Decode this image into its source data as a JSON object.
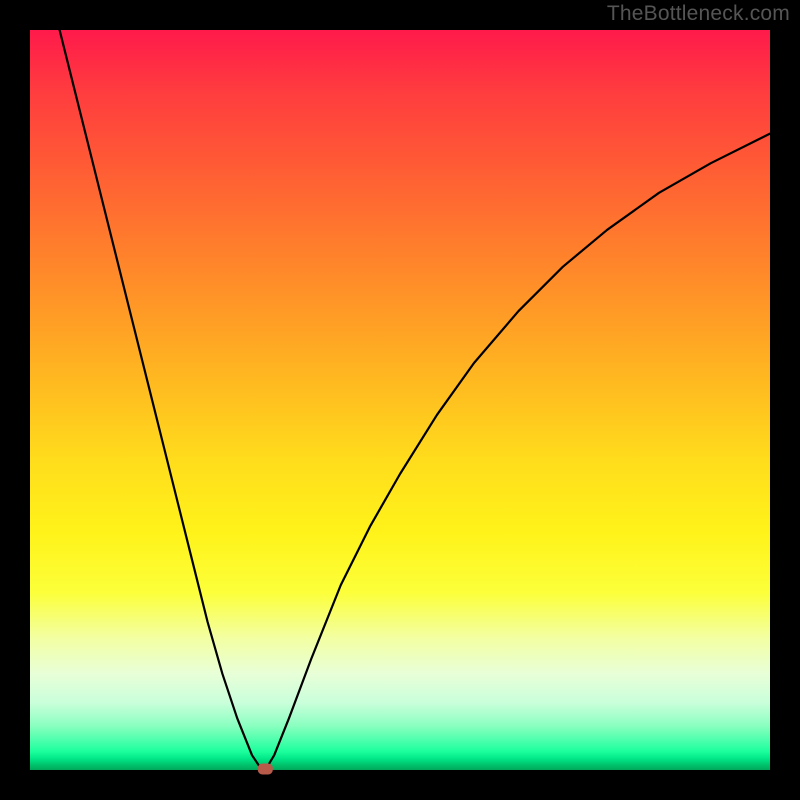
{
  "attribution": "TheBottleneck.com",
  "colors": {
    "frame": "#000000",
    "curve_stroke": "#000000",
    "marker_fill": "#b85a4a",
    "gradient_stops": [
      "#ff1a4b",
      "#ff3b3f",
      "#ff5a35",
      "#ff7a2d",
      "#ff9a26",
      "#ffbb20",
      "#ffdc1c",
      "#fff31a",
      "#fcff3a",
      "#f3ffa0",
      "#e8ffd8",
      "#c8ffda",
      "#8affc0",
      "#4cffac",
      "#1cff9c",
      "#00e687",
      "#00c76f",
      "#00a85a"
    ]
  },
  "chart_data": {
    "type": "line",
    "title": "",
    "xlabel": "",
    "ylabel": "",
    "xlim": [
      0,
      100
    ],
    "ylim": [
      0,
      100
    ],
    "grid": false,
    "series": [
      {
        "name": "bottleneck-curve",
        "x": [
          4,
          6,
          8,
          10,
          12,
          14,
          16,
          18,
          20,
          22,
          24,
          26,
          28,
          30,
          31,
          31.8,
          33,
          35,
          38,
          42,
          46,
          50,
          55,
          60,
          66,
          72,
          78,
          85,
          92,
          100
        ],
        "y": [
          100,
          92,
          84,
          76,
          68,
          60,
          52,
          44,
          36,
          28,
          20,
          13,
          7,
          2,
          0.5,
          0,
          2,
          7,
          15,
          25,
          33,
          40,
          48,
          55,
          62,
          68,
          73,
          78,
          82,
          86
        ]
      }
    ],
    "annotations": [
      {
        "name": "optimal-point",
        "x": 31.8,
        "y": 0
      }
    ],
    "background": "vertical-gradient red→yellow→green (green at bottom)"
  }
}
